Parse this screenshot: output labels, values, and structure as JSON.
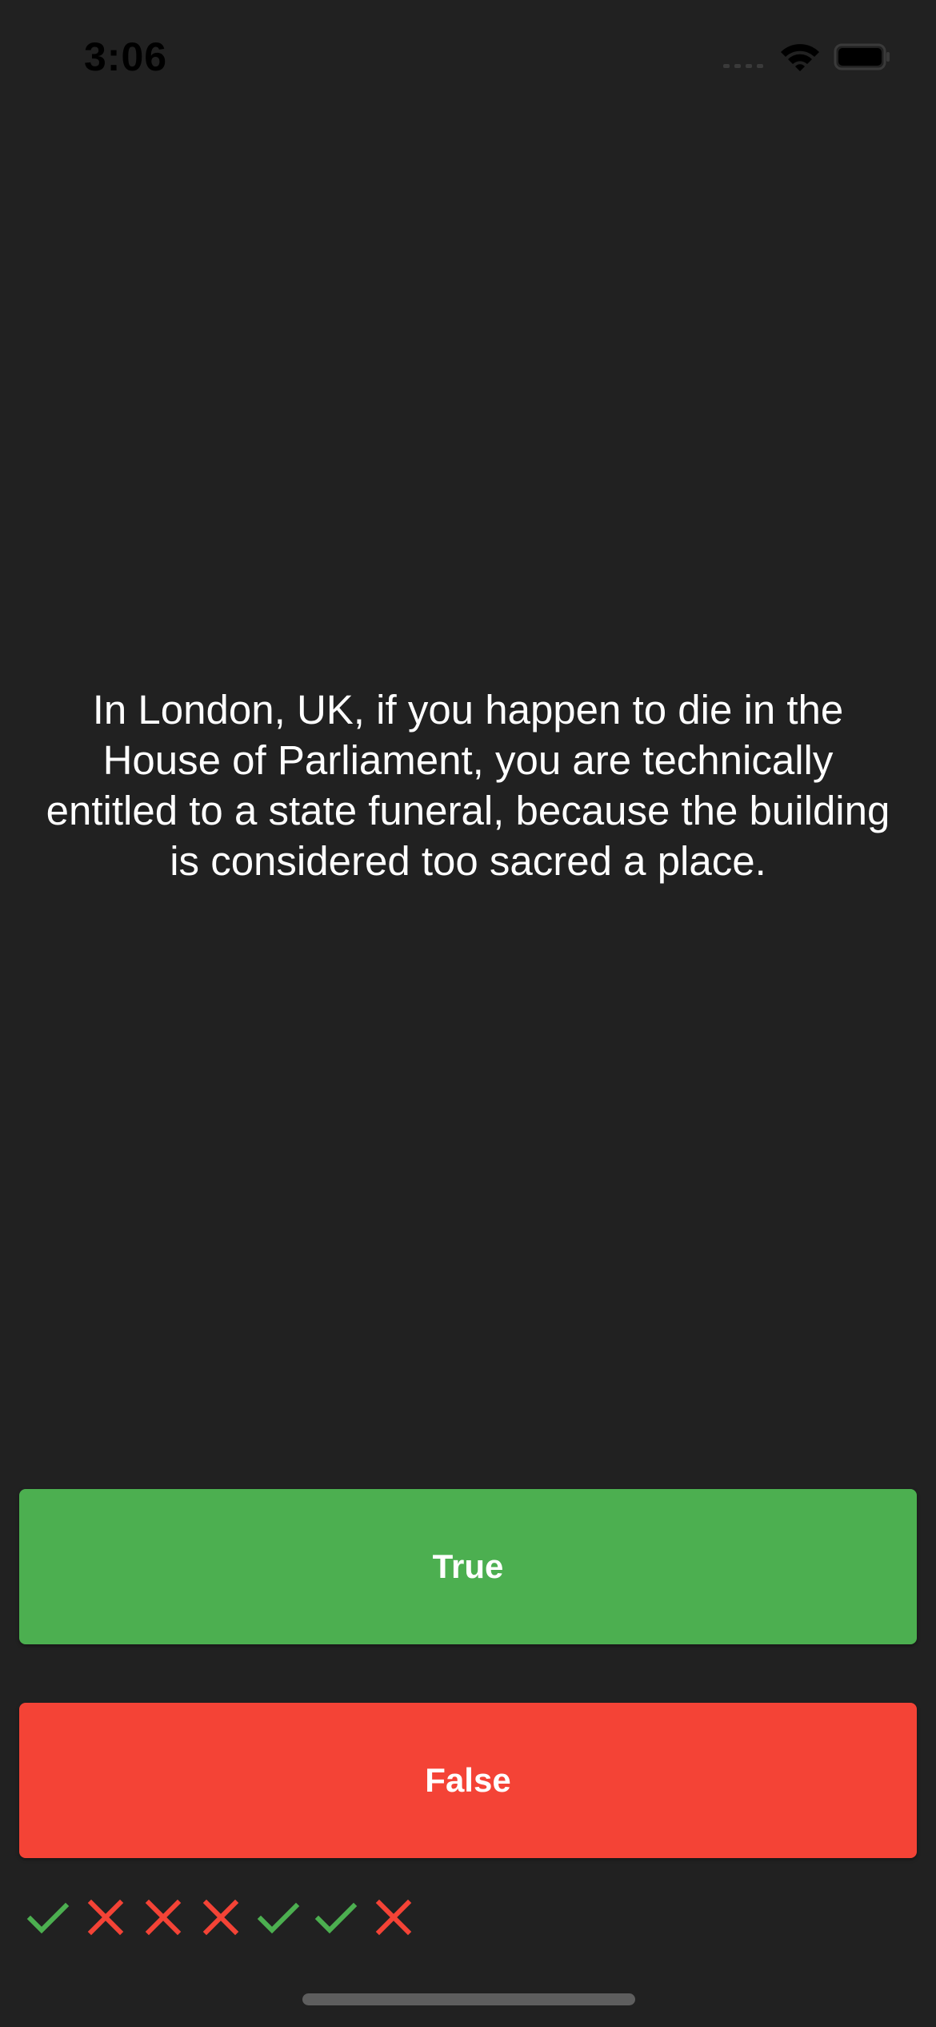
{
  "status_bar": {
    "time": "3:06",
    "icons": [
      "signal-icon",
      "wifi-icon",
      "battery-icon"
    ]
  },
  "quiz": {
    "question": "In London, UK, if you happen to die in the House of Parliament, you are technically entitled to a state funeral, because the building is considered too sacred a place.",
    "true_label": "True",
    "false_label": "False"
  },
  "score_keeper": [
    "correct",
    "wrong",
    "wrong",
    "wrong",
    "correct",
    "correct",
    "wrong"
  ],
  "colors": {
    "background": "#212121",
    "true_button": "#4caf50",
    "false_button": "#f44336",
    "check": "#4caf50",
    "cross": "#f44336"
  }
}
